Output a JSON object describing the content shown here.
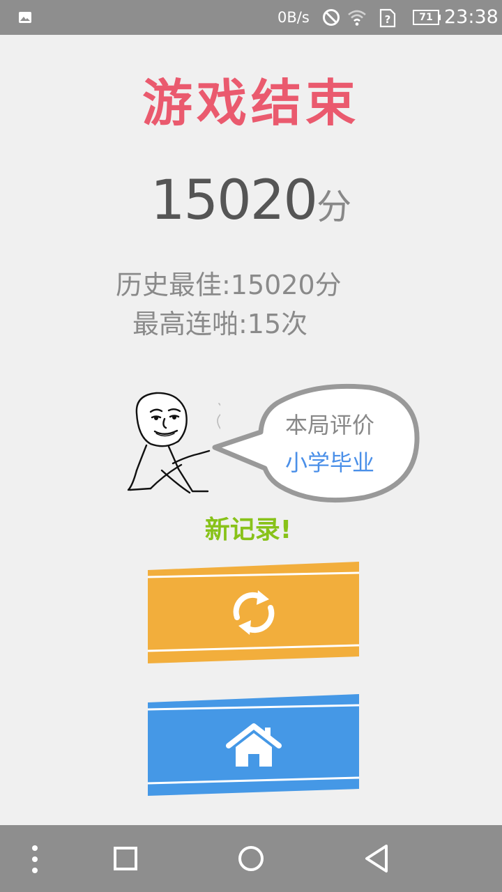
{
  "status_bar": {
    "net_speed": "0B/s",
    "battery": "71",
    "time": "23:38",
    "icons": [
      "image-icon",
      "do-not-disturb-icon",
      "wifi-icon",
      "no-sim-icon",
      "battery-icon"
    ]
  },
  "result": {
    "title": "游戏结束",
    "score": "15020",
    "score_unit": "分",
    "best_score": "历史最佳:15020分",
    "max_combo": "最高连啪:15次"
  },
  "evaluation": {
    "label": "本局评价",
    "rating": "小学毕业"
  },
  "new_record": "新记录!",
  "buttons": {
    "restart_icon": "refresh-icon",
    "home_icon": "home-icon"
  },
  "nav_bar": {
    "icons": [
      "menu-dots-icon",
      "recents-icon",
      "home-circle-icon",
      "back-icon"
    ]
  },
  "colors": {
    "title": "#ea5a6e",
    "new_record": "#88c219",
    "rating": "#4a8fe8",
    "restart_button": "#f2ae3c",
    "home_button": "#4598e6",
    "bars": "#8e8e8e"
  }
}
